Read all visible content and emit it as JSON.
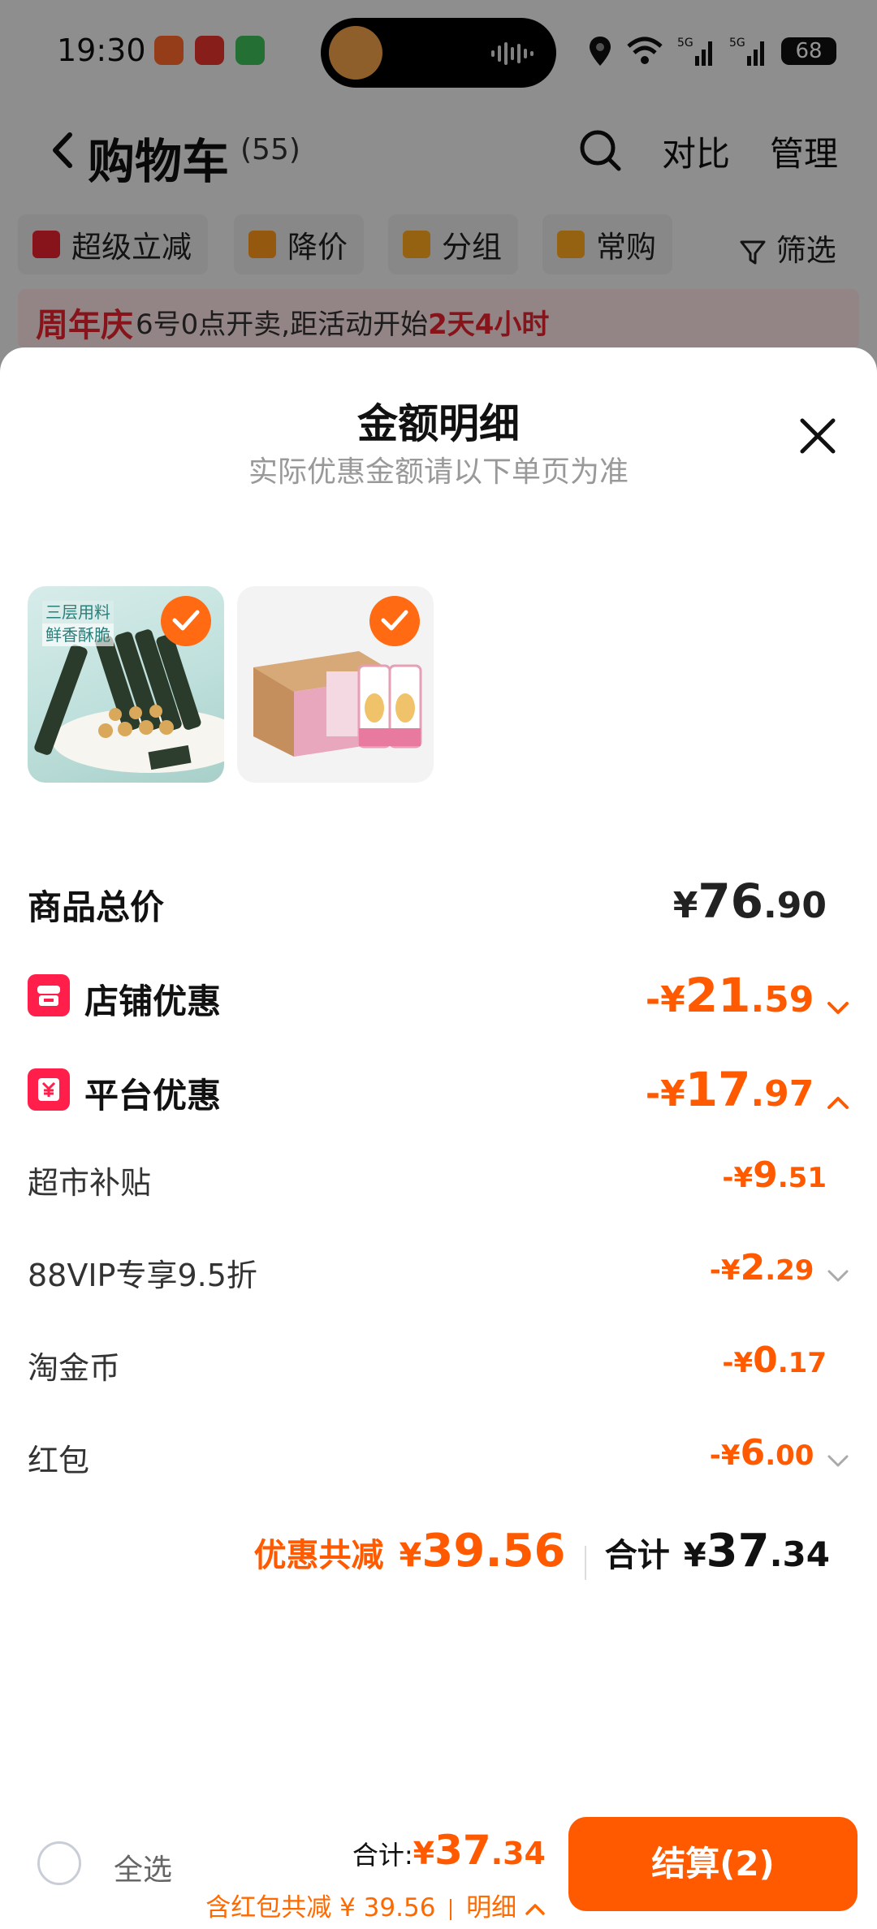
{
  "status": {
    "time": "19:30",
    "battery": "68"
  },
  "header": {
    "title": "购物车",
    "count": "(55)",
    "compare": "对比",
    "manage": "管理"
  },
  "chips": [
    "超级立减",
    "降价",
    "分组",
    "常购"
  ],
  "filter": "筛选",
  "promo": {
    "tag": "周年庆",
    "text": "6号0点开卖,距活动开始",
    "highlight": "2天4小时"
  },
  "sheet": {
    "title": "金额明细",
    "subtitle": "实际优惠金额请以下单页为准",
    "thumb1_text": [
      "三层用料",
      "鲜香酥脆"
    ],
    "subtotal": {
      "label": "商品总价",
      "currency": "¥",
      "int": "76",
      "dec": ".90"
    },
    "shop_discount": {
      "label": "店铺优惠",
      "prefix": "-¥",
      "int": "21",
      "dec": ".59"
    },
    "platform_discount": {
      "label": "平台优惠",
      "prefix": "-¥",
      "int": "17",
      "dec": ".97"
    },
    "items": [
      {
        "label": "超市补贴",
        "prefix": "-¥",
        "int": "9",
        "dec": ".51"
      },
      {
        "label": "88VIP专享9.5折",
        "prefix": "-¥",
        "int": "2",
        "dec": ".29"
      },
      {
        "label": "淘金币",
        "prefix": "-¥",
        "int": "0",
        "dec": ".17"
      },
      {
        "label": "红包",
        "prefix": "-¥",
        "int": "6",
        "dec": ".00"
      }
    ],
    "summary": {
      "discount_label": "优惠共减",
      "discount_currency": "¥",
      "discount_value": "39.56",
      "total_label": "合计",
      "total_currency": "¥",
      "total_int": "37",
      "total_dec": ".34"
    }
  },
  "bottom": {
    "select_all": "全选",
    "total_label": "合计:",
    "total_currency": "¥",
    "total_int": "37",
    "total_dec": ".34",
    "note": "含红包共减 ¥ 39.56",
    "detail": "明细",
    "checkout": "结算(2)"
  },
  "colors": {
    "accent": "#ff5a00",
    "red": "#e8242d",
    "badge": "#ff1f4a"
  }
}
